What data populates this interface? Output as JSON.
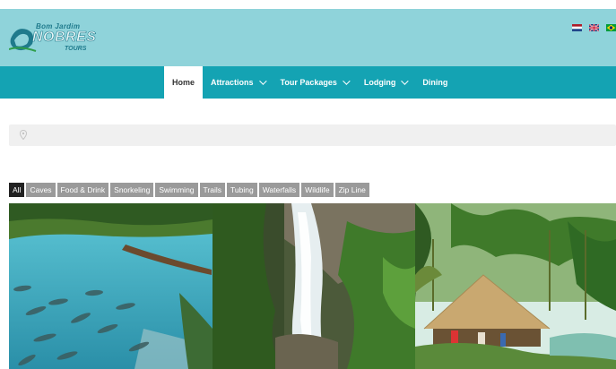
{
  "brand": {
    "line1": "Bom Jardim",
    "line2": "NOBRES",
    "line3": "TOURS"
  },
  "languages": [
    {
      "code": "nl",
      "icon": "netherlands-flag-icon"
    },
    {
      "code": "en",
      "icon": "uk-flag-icon"
    },
    {
      "code": "pt",
      "icon": "brazil-flag-icon"
    }
  ],
  "nav": {
    "items": [
      {
        "label": "Home",
        "active": true,
        "dropdown": false
      },
      {
        "label": "Attractions",
        "active": false,
        "dropdown": true
      },
      {
        "label": "Tour Packages",
        "active": false,
        "dropdown": true
      },
      {
        "label": "Lodging",
        "active": false,
        "dropdown": true
      },
      {
        "label": "Dining",
        "active": false,
        "dropdown": false
      }
    ]
  },
  "search": {
    "placeholder": "",
    "icon": "map-pin-icon"
  },
  "filters": [
    {
      "label": "All",
      "active": true
    },
    {
      "label": "Caves",
      "active": false
    },
    {
      "label": "Food & Drink",
      "active": false
    },
    {
      "label": "Snorkeling",
      "active": false
    },
    {
      "label": "Swimming",
      "active": false
    },
    {
      "label": "Trails",
      "active": false
    },
    {
      "label": "Tubing",
      "active": false
    },
    {
      "label": "Waterfalls",
      "active": false
    },
    {
      "label": "Wildlife",
      "active": false
    },
    {
      "label": "Zip Line",
      "active": false
    }
  ],
  "gallery": [
    {
      "name": "photo-clear-river-fish"
    },
    {
      "name": "photo-waterfall"
    },
    {
      "name": "photo-thatched-hut"
    }
  ],
  "colors": {
    "header_bg": "#8fd3da",
    "nav_bg": "#14a3b3",
    "filter_bg": "#9a9a9a",
    "filter_active_bg": "#222222"
  }
}
